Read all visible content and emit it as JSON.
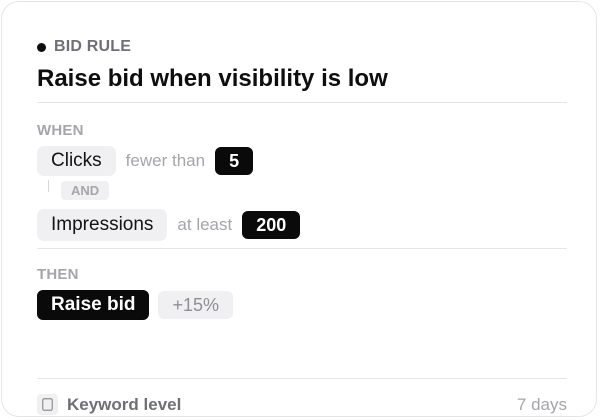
{
  "rule": {
    "eyebrow": "BID RULE",
    "title": "Raise bid when visibility is low"
  },
  "when": {
    "label": "WHEN",
    "conditions": [
      {
        "metric": "Clicks",
        "operator": "fewer than",
        "value": "5"
      },
      {
        "metric": "Impressions",
        "operator": "at least",
        "value": "200"
      }
    ],
    "joiner": "AND"
  },
  "then": {
    "label": "THEN",
    "action": "Raise bid",
    "amount": "+15%"
  },
  "footer": {
    "level_icon": "square-icon",
    "level": "Keyword level",
    "window": "7 days"
  },
  "colors": {
    "ink": "#0a0a0a",
    "chip_bg": "#f0f0f2",
    "muted": "#a5a5ac",
    "subtle": "#6f6f78",
    "border": "#e6e6e9"
  }
}
